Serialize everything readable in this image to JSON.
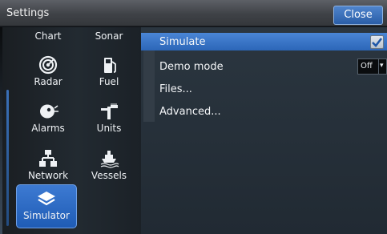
{
  "window": {
    "title": "Settings",
    "close_label": "Close"
  },
  "sidebar": {
    "items": [
      {
        "label": "Chart",
        "icon": "chart-icon"
      },
      {
        "label": "Sonar",
        "icon": "sonar-icon"
      },
      {
        "label": "Radar",
        "icon": "radar-icon"
      },
      {
        "label": "Fuel",
        "icon": "fuel-icon"
      },
      {
        "label": "Alarms",
        "icon": "alarm-icon"
      },
      {
        "label": "Units",
        "icon": "units-icon"
      },
      {
        "label": "Network",
        "icon": "network-icon"
      },
      {
        "label": "Vessels",
        "icon": "vessel-icon"
      },
      {
        "label": "Simulator",
        "icon": "simulator-icon",
        "active": true
      }
    ]
  },
  "main": {
    "rows": [
      {
        "label": "Simulate",
        "control": "checkbox",
        "checked": true,
        "selected": true
      },
      {
        "label": "Demo mode",
        "control": "dropdown",
        "value": "Off"
      },
      {
        "label": "Files..."
      },
      {
        "label": "Advanced..."
      }
    ]
  },
  "colors": {
    "accent": "#2f6cc0",
    "titlebar": "#45484d",
    "background": "#222b34"
  }
}
